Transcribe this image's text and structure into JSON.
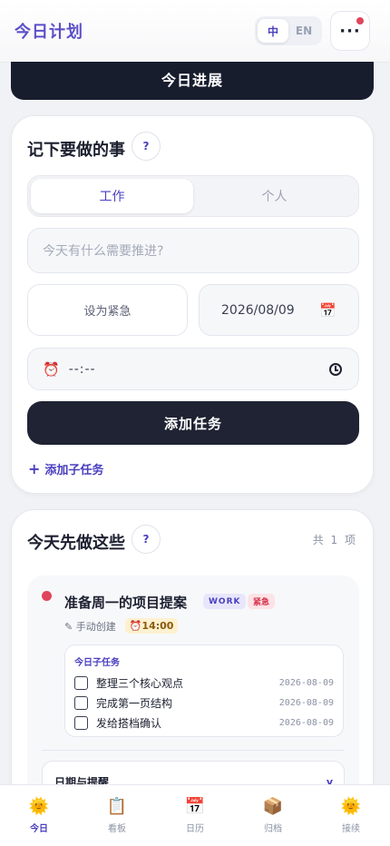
{
  "header": {
    "title": "今日计划",
    "lang_options": [
      "中",
      "EN"
    ],
    "lang_active": "中",
    "more_label": "···"
  },
  "progress_banner": {
    "label": "今日进展"
  },
  "input_card": {
    "title": "记下要做的事",
    "help_label": "?",
    "segments": [
      "工作",
      "个人"
    ],
    "active_segment": "工作",
    "task_placeholder": "今天有什么需要推进?",
    "urgent_label": "设为紧急",
    "date_value": "2026/08/09",
    "time_value": "--:--",
    "add_button": "添加任务",
    "add_subtask": "添加子任务"
  },
  "list_card": {
    "title": "今天先做这些",
    "help_label": "?",
    "count_label": "共 1 项",
    "tasks": [
      {
        "title": "准备周一的项目提案",
        "badge_work": "WORK",
        "badge_urgent": "紧急",
        "source": "✎ 手动创建",
        "time": "⏰14:00",
        "subtask_header": "今日子任务",
        "subtasks": [
          {
            "label": "整理三个核心观点",
            "date": "2026-08-09"
          },
          {
            "label": "完成第一页结构",
            "date": "2026-08-09"
          },
          {
            "label": "发给搭档确认",
            "date": "2026-08-09"
          }
        ],
        "reminder_title": "日期与提醒"
      }
    ]
  },
  "bottom_nav": {
    "items": [
      {
        "label": "今日",
        "icon": "🌞"
      },
      {
        "label": "看板",
        "icon": "📋"
      },
      {
        "label": "日历",
        "icon": "📅"
      },
      {
        "label": "归档",
        "icon": "📦"
      },
      {
        "label": "接续",
        "icon": "🌞"
      }
    ],
    "active": "今日"
  },
  "colors": {
    "accent": "#4a3fc0",
    "dark": "#181d2e",
    "urgent": "#e0455b"
  }
}
